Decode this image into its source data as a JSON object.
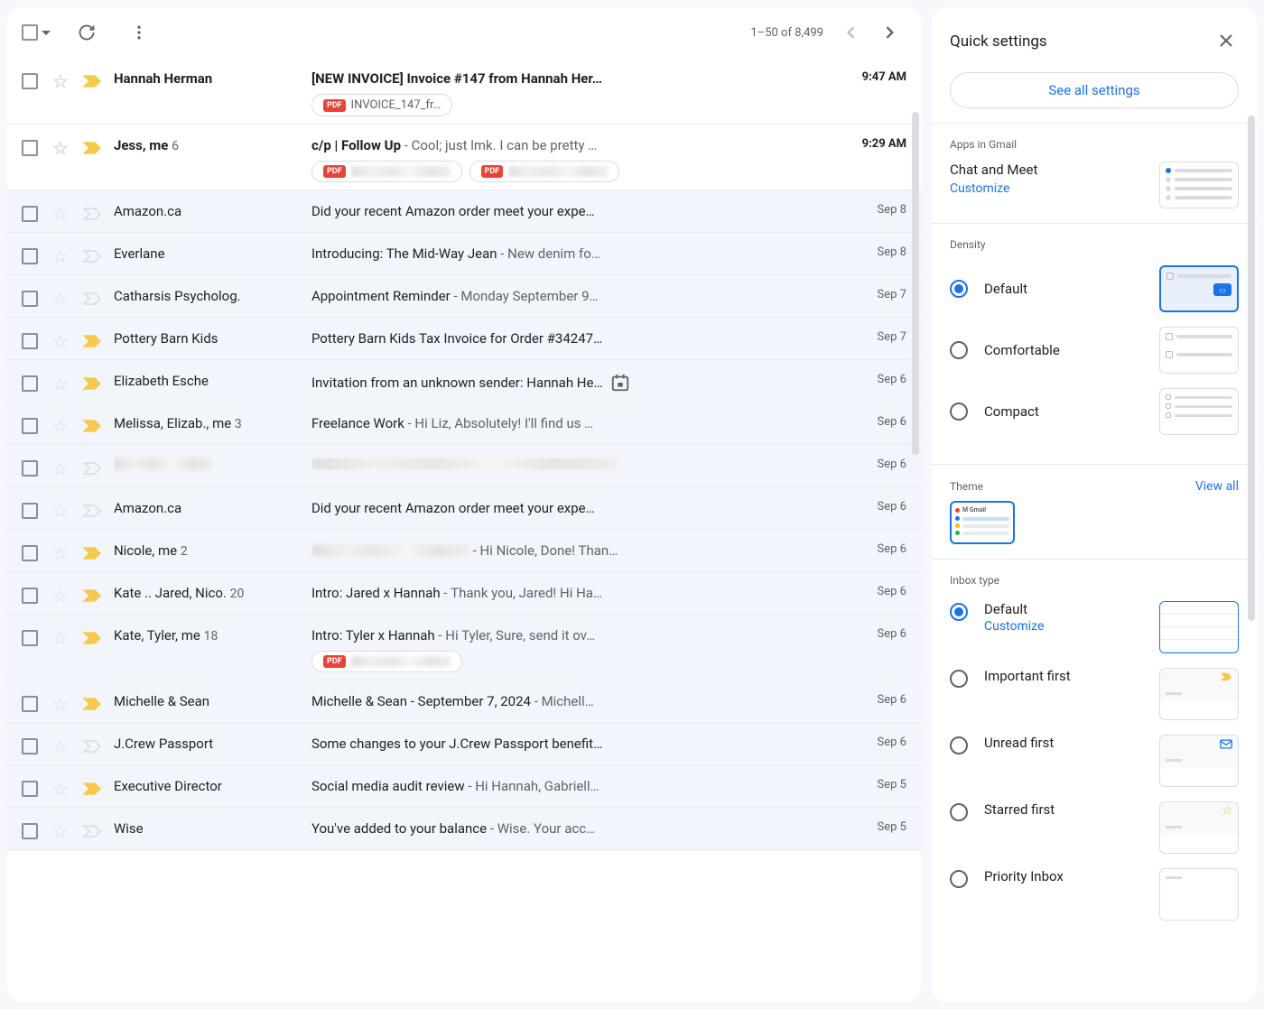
{
  "toolbar": {
    "pagination": "1–50 of 8,499"
  },
  "emails": [
    {
      "sender": "Hannah Herman",
      "count": "",
      "subject": "[NEW INVOICE] Invoice #147 from Hannah Her…",
      "preview": "",
      "date": "9:47 AM",
      "unread": true,
      "important": true,
      "attachments": [
        {
          "name": "INVOICE_147_fr…",
          "type": "pdf"
        }
      ]
    },
    {
      "sender": "Jess, me",
      "count": "6",
      "subject": "c/p | Follow Up",
      "preview": "Cool; just lmk. I can be pretty …",
      "date": "9:29 AM",
      "unread": true,
      "important": true,
      "attachments": [
        {
          "name": "",
          "type": "pdf",
          "blurred": true
        },
        {
          "name": "",
          "type": "pdf",
          "blurred": true
        }
      ]
    },
    {
      "sender": "Amazon.ca",
      "count": "",
      "subject": "Did your recent Amazon order meet your expe…",
      "preview": "",
      "date": "Sep 8",
      "unread": false,
      "important": false
    },
    {
      "sender": "Everlane",
      "count": "",
      "subject": "Introducing: The Mid-Way Jean",
      "preview": "New denim fo…",
      "date": "Sep 8",
      "unread": false,
      "important": false
    },
    {
      "sender": "Catharsis Psycholog.",
      "count": "",
      "subject": "Appointment Reminder",
      "preview": "Monday September 9…",
      "date": "Sep 7",
      "unread": false,
      "important": false
    },
    {
      "sender": "Pottery Barn Kids",
      "count": "",
      "subject": "Pottery Barn Kids Tax Invoice for Order #34247…",
      "preview": "",
      "date": "Sep 7",
      "unread": false,
      "important": true
    },
    {
      "sender": "Elizabeth Esche",
      "count": "",
      "subject": "Invitation from an unknown sender: Hannah He…",
      "preview": "",
      "date": "Sep 6",
      "unread": false,
      "important": true,
      "calendar": true
    },
    {
      "sender": "Melissa, Elizab., me",
      "count": "3",
      "subject": "Freelance Work",
      "preview": "Hi Liz, Absolutely! I'll find us …",
      "date": "Sep 6",
      "unread": false,
      "important": true
    },
    {
      "sender": "",
      "count": "",
      "subject": "",
      "preview": "",
      "date": "Sep 6",
      "unread": false,
      "important": false,
      "blurred": true
    },
    {
      "sender": "Amazon.ca",
      "count": "",
      "subject": "Did your recent Amazon order meet your expe…",
      "preview": "",
      "date": "Sep 6",
      "unread": false,
      "important": false
    },
    {
      "sender": "Nicole, me",
      "count": "2",
      "subject": "",
      "preview": "Hi Nicole, Done! Than…",
      "date": "Sep 6",
      "unread": false,
      "important": true,
      "subjectBlurred": true
    },
    {
      "sender": "Kate .. Jared, Nico.",
      "count": "20",
      "subject": "Intro: Jared x Hannah",
      "preview": "Thank you, Jared! Hi Ha…",
      "date": "Sep 6",
      "unread": false,
      "important": true
    },
    {
      "sender": "Kate, Tyler, me",
      "count": "18",
      "subject": "Intro: Tyler x Hannah",
      "preview": "Hi Tyler, Sure, send it ov…",
      "date": "Sep 6",
      "unread": false,
      "important": true,
      "attachments": [
        {
          "name": "",
          "type": "pdf",
          "blurred": true
        }
      ]
    },
    {
      "sender": "Michelle & Sean",
      "count": "",
      "subject": "Michelle & Sean - September 7, 2024",
      "preview": "Michell…",
      "date": "Sep 6",
      "unread": false,
      "important": true
    },
    {
      "sender": "J.Crew Passport",
      "count": "",
      "subject": "Some changes to your J.Crew Passport benefit…",
      "preview": "",
      "date": "Sep 6",
      "unread": false,
      "important": false
    },
    {
      "sender": "Executive Director",
      "count": "",
      "subject": "Social media audit review",
      "preview": "Hi Hannah, Gabriell…",
      "date": "Sep 5",
      "unread": false,
      "important": true
    },
    {
      "sender": "Wise",
      "count": "",
      "subject": "You've added to your balance",
      "preview": "Wise. Your acc…",
      "date": "Sep 5",
      "unread": false,
      "important": false
    }
  ],
  "settings": {
    "title": "Quick settings",
    "see_all": "See all settings",
    "apps": {
      "title": "Apps in Gmail",
      "label": "Chat and Meet",
      "link": "Customize"
    },
    "density": {
      "title": "Density",
      "options": [
        "Default",
        "Comfortable",
        "Compact"
      ],
      "selected": 0
    },
    "theme": {
      "title": "Theme",
      "link": "View all"
    },
    "inbox": {
      "title": "Inbox type",
      "options": [
        {
          "label": "Default",
          "sub": "Customize"
        },
        {
          "label": "Important first"
        },
        {
          "label": "Unread first"
        },
        {
          "label": "Starred first"
        },
        {
          "label": "Priority Inbox"
        }
      ],
      "selected": 0
    }
  }
}
